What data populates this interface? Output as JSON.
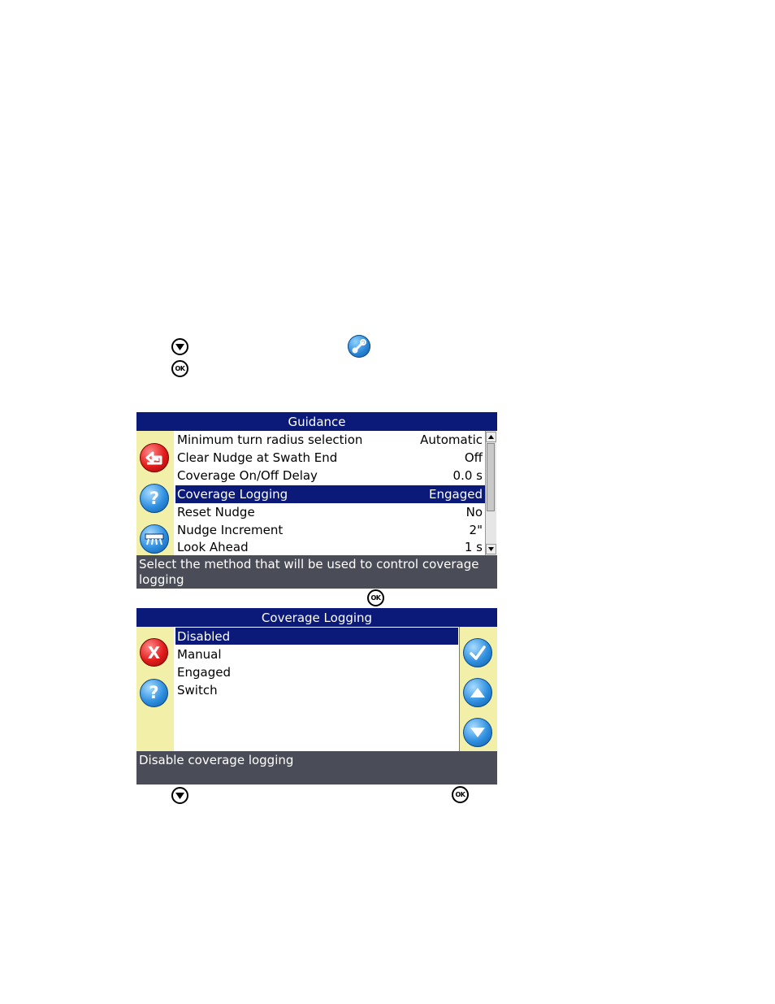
{
  "guidance_screen": {
    "title": "Guidance",
    "items": [
      {
        "label": "Minimum turn radius selection",
        "value": "Automatic"
      },
      {
        "label": "Clear Nudge at Swath End",
        "value": "Off"
      },
      {
        "label": "Coverage On/Off Delay",
        "value": "0.0 s"
      },
      {
        "label": "Coverage Logging",
        "value": "Engaged"
      },
      {
        "label": "Reset Nudge",
        "value": "No"
      },
      {
        "label": "Nudge Increment",
        "value": "2\""
      },
      {
        "label": "Look Ahead",
        "value": "1 s"
      }
    ],
    "selected_index": 3,
    "info": "Select the method that will be used to control coverage logging"
  },
  "coverage_screen": {
    "title": "Coverage Logging",
    "options": [
      "Disabled",
      "Manual",
      "Engaged",
      "Switch"
    ],
    "selected_index": 0,
    "info": "Disable coverage logging"
  },
  "key_ok_label": "OK",
  "icons": {
    "back": "back-arrow-icon",
    "help": "help-icon",
    "implement": "implement-icon",
    "cancel": "cancel-x-icon",
    "accept": "checkmark-icon",
    "up": "up-arrow-icon",
    "down": "down-arrow-icon",
    "setup": "wrench-icon"
  },
  "colors": {
    "title_bar": "#0b1a78",
    "panel": "#f2f0a8",
    "info_bar": "#4a4d57",
    "selection": "#0b1a78"
  }
}
